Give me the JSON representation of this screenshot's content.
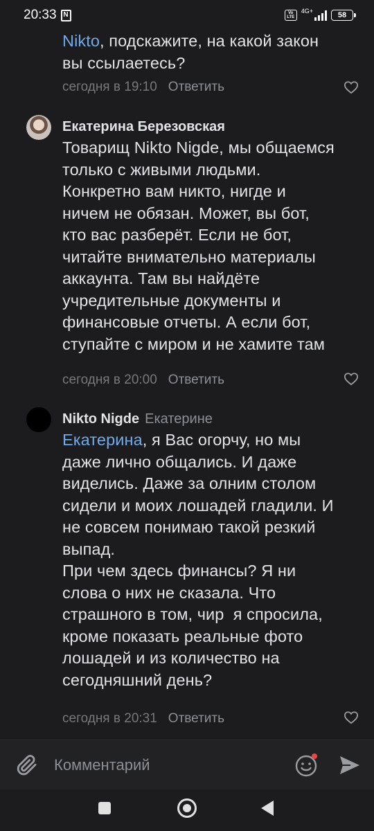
{
  "status_bar": {
    "time": "20:33",
    "nfc": "N",
    "volte_top": "Vo",
    "volte_bottom": "LTE",
    "network": "4G+",
    "battery": "58"
  },
  "comments": [
    {
      "mention": "Nikto",
      "text_line1_rest": ", подскажите, на какой закон",
      "text_rest": "вы ссылаетесь?",
      "timestamp": "сегодня в 19:10",
      "reply_label": "Ответить"
    },
    {
      "author": "Екатерина Березовская",
      "text": "Товарищ Nikto Nigde, мы общаемся\nтолько с живыми людьми.\nКонкретно вам никто, нигде и\nничем не обязан. Может, вы бот,\nкто вас разберёт. Если не бот,\nчитайте внимательно материалы\nаккаунта. Там вы найдёте\nучредительные документы и\nфинансовые отчеты. А если бот,\nступайте с миром и не хамите там",
      "timestamp": "сегодня в 20:00",
      "reply_label": "Ответить"
    },
    {
      "author": "Nikto Nigde",
      "reply_to": "Екатерине",
      "mention": "Екатерина",
      "text_line1_rest": ", я Вас огорчу, но мы",
      "text_rest": "даже лично общались. И даже\nвиделись. Даже за олним столом\nсидели и моих лошадей гладили. И\nне совсем понимаю такой резкий\nвыпад.\nПри чем здесь финансы? Я ни\nслова о них не сказала. Что\nстрашного в том, чир  я спросила,\nкроме показать реальные фото\nлошадей и из количество на\nсегодняшний день?",
      "timestamp": "сегодня в 20:31",
      "reply_label": "Ответить"
    }
  ],
  "composer": {
    "placeholder": "Комментарий"
  },
  "icons": {
    "like": "heart-outline-icon",
    "attach": "paperclip-icon",
    "emoji": "emoji-smile-icon",
    "send": "send-arrow-icon"
  },
  "colors": {
    "background": "#1c1c1e",
    "text": "#e1e3e6",
    "mention": "#71aaeb",
    "meta": "#76787a",
    "notification_dot": "#e64646"
  }
}
